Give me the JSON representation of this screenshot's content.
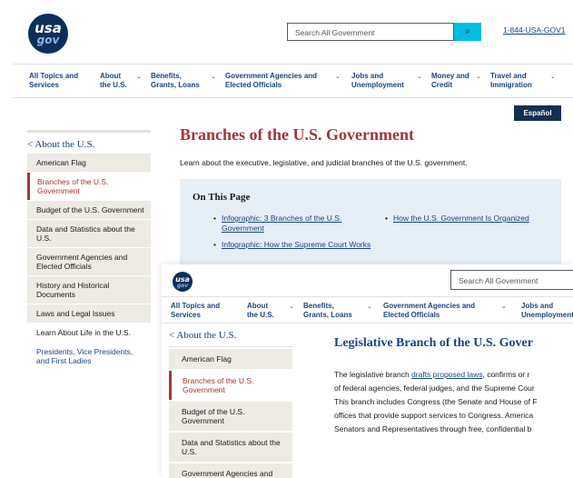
{
  "brand": {
    "logo_line1": "usa",
    "logo_line2": "gov"
  },
  "header": {
    "search_placeholder": "Search All Government",
    "search_button_icon": "search-icon",
    "phone": "1-844-USA-GOV1"
  },
  "nav": {
    "items": [
      {
        "label_line1": "All Topics and",
        "label_line2": "Services"
      },
      {
        "label_line1": "About",
        "label_line2": "the U.S."
      },
      {
        "label_line1": "Benefits,",
        "label_line2": "Grants, Loans"
      },
      {
        "label_line1": "Government Agencies and",
        "label_line2": "Elected Officials"
      },
      {
        "label_line1": "Jobs and",
        "label_line2": "Unemployment"
      },
      {
        "label_line1": "Money and",
        "label_line2": "Credit"
      },
      {
        "label_line1": "Travel and",
        "label_line2": "Immigration"
      }
    ]
  },
  "back_page": {
    "language_button": "Español",
    "sidebar_title": "< About the U.S.",
    "sidebar_items": [
      "American Flag",
      "Branches of the U.S. Government",
      "Budget of the U.S. Government",
      "Data and Statistics about the U.S.",
      "Government Agencies and Elected Officials",
      "History and Historical Documents",
      "Laws and Legal Issues",
      "Learn About Life in the U.S.",
      "Presidents, Vice Presidents, and First Ladies"
    ],
    "title": "Branches of the U.S. Government",
    "lead": "Learn about the executive, legislative, and judicial branches of the U.S. government.",
    "on_this_page": {
      "heading": "On This Page",
      "links": [
        "Infographic: 3 Branches of the U.S. Government",
        "How the U.S. Government Is Organized",
        "Infographic: How the Supreme Court Works"
      ]
    }
  },
  "front_page": {
    "search_placeholder": "Search All Government",
    "sidebar_title": "< About the U.S.",
    "sidebar_items": [
      "American Flag",
      "Branches of the U.S. Government",
      "Budget of the U.S. Government",
      "Data and Statistics about the U.S.",
      "Government Agencies and Elected Officials"
    ],
    "title": "Legislative Branch of the U.S. Gover",
    "body_lines": [
      {
        "pre": "The legislative branch ",
        "link": "drafts proposed laws",
        "post": ", confirms or r"
      },
      {
        "pre": "of federal agencies, federal judges, and the Supreme Cour",
        "link": "",
        "post": ""
      },
      {
        "pre": "This branch includes Congress (the Senate and House of F",
        "link": "",
        "post": ""
      },
      {
        "pre": "offices that provide support services to Congress. America",
        "link": "",
        "post": ""
      },
      {
        "pre": "Senators and Representatives through free, confidential b",
        "link": "",
        "post": ""
      }
    ]
  },
  "colors": {
    "navy": "#0b2f5a",
    "link_blue": "#1a4480",
    "accent_red": "#a23737",
    "search_cyan": "#00bde3",
    "sidebar_bg": "#eeeae4",
    "callout_bg": "#e6eef6"
  }
}
